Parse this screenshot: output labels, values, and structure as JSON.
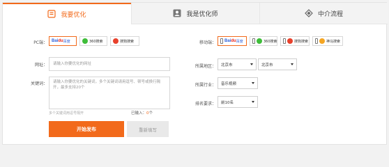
{
  "tabs": [
    {
      "label": "我要优化",
      "icon": "optimize-icon",
      "active": true
    },
    {
      "label": "我是优化师",
      "icon": "user-icon",
      "active": false
    },
    {
      "label": "中介流程",
      "icon": "diamond-icon",
      "active": false
    }
  ],
  "colors": {
    "accent": "#f26a1b",
    "baidu_blue": "#2b5fd9",
    "baidu_red": "#e62117",
    "so360_green": "#3fbd3a",
    "sogou_red": "#e8412c",
    "shenma_orange": "#f5a623"
  },
  "form": {
    "pc_label": "PC端：",
    "pc_engines": [
      {
        "label": "百度",
        "logo": "Bai",
        "logo_mark": "du",
        "selected": true
      },
      {
        "label": "360搜索",
        "selected": false
      },
      {
        "label": "搜狗搜索",
        "selected": false
      }
    ],
    "mobile_label": "移动端：",
    "mobile_engines": [
      {
        "label": "百度",
        "logo": "Bai",
        "logo_mark": "du",
        "selected": true
      },
      {
        "label": "360搜索",
        "selected": false
      },
      {
        "label": "搜狗搜索",
        "selected": false
      },
      {
        "label": "神马搜索",
        "selected": false
      }
    ],
    "url_label": "网址：",
    "url_placeholder": "请输入你要优化的网址",
    "keyword_label": "关键词：",
    "keyword_placeholder": "请输入你要优化的关键词，多个关键词请用逗号、顿号或换行隔开，最多支持20个",
    "keyword_hint": "多个关键词用逗号隔开",
    "entered_label": "已输入：",
    "entered_count": "0",
    "entered_unit": "个",
    "region_label": "所属地区：",
    "province": "北京市",
    "city": "北京市",
    "industry_label": "所属行业：",
    "industry": "音乐视频",
    "rank_label": "排名要求：",
    "rank": "前10名",
    "submit": "开始发布",
    "reset": "重新填写"
  }
}
